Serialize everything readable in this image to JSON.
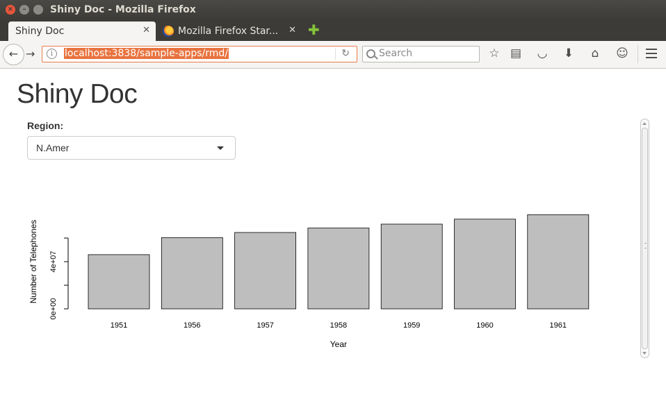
{
  "window": {
    "title": "Shiny Doc - Mozilla Firefox"
  },
  "tabs": [
    {
      "label": "Shiny Doc",
      "active": true
    },
    {
      "label": "Mozilla Firefox Star...",
      "active": false
    }
  ],
  "navbar": {
    "url": "localhost:3838/sample-apps/rmd/",
    "search_placeholder": "Search"
  },
  "page": {
    "title": "Shiny Doc",
    "region_label": "Region:",
    "region_value": "N.Amer"
  },
  "chart_data": {
    "type": "bar",
    "categories": [
      "1951",
      "1956",
      "1957",
      "1958",
      "1959",
      "1960",
      "1961"
    ],
    "values": [
      45939000,
      60423000,
      64721000,
      68484000,
      71799000,
      76036000,
      79831000
    ],
    "xlabel": "Year",
    "ylabel": "Number of Telephones",
    "yticks": [
      0,
      20000000,
      40000000,
      60000000
    ],
    "ytick_labels": [
      "0e+00",
      "",
      "4e+07",
      ""
    ],
    "ylim": [
      0,
      80000000
    ],
    "bar_color": "#bebebe",
    "grid": false
  }
}
